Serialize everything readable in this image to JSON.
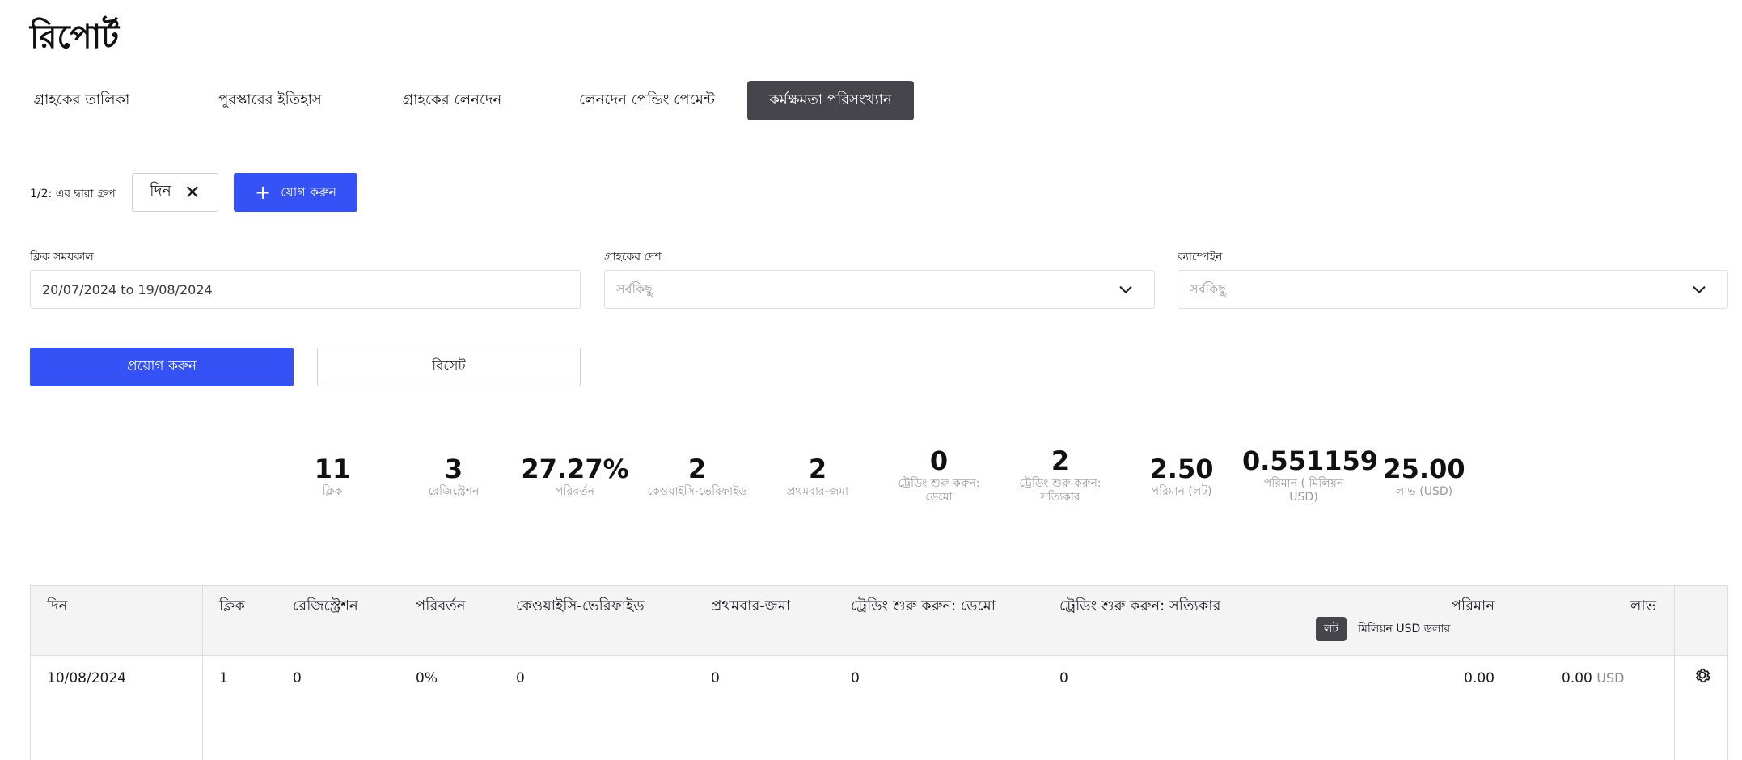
{
  "page": {
    "title": "রিপোর্ট"
  },
  "tabs": [
    {
      "label": "গ্রাহকের তালিকা",
      "active": false
    },
    {
      "label": "পুরস্কারের ইতিহাস",
      "active": false
    },
    {
      "label": "গ্রাহকের লেনদেন",
      "active": false
    },
    {
      "label": "লেনদেন পেন্ডিং পেমেন্ট",
      "active": false
    },
    {
      "label": "কর্মক্ষমতা পরিসংখ্যান",
      "active": true
    }
  ],
  "group_by": {
    "label": "1/2: এর দ্বারা গ্রুপ",
    "chip_label": "দিন",
    "add_button_label": "যোগ করুন"
  },
  "filters": {
    "period": {
      "label": "ক্লিক সময়কাল",
      "value": "20/07/2024 to 19/08/2024"
    },
    "country": {
      "label": "গ্রাহকের দেশ",
      "placeholder": "সর্বকিছু"
    },
    "campaign": {
      "label": "ক্যাম্পেইন",
      "placeholder": "সর্বকিছু"
    }
  },
  "actions": {
    "apply_label": "প্রয়োগ করুন",
    "reset_label": "রিসেট"
  },
  "stats": [
    {
      "value": "11",
      "label_lines": [
        "ক্লিক"
      ]
    },
    {
      "value": "3",
      "label_lines": [
        "রেজিস্ট্রেশন"
      ]
    },
    {
      "value": "27.27%",
      "label_lines": [
        "পরিবর্তন"
      ]
    },
    {
      "value": "2",
      "label_lines": [
        "কেওয়াইসি-ভেরিফাইড"
      ]
    },
    {
      "value": "2",
      "label_lines": [
        "প্রথমবার-জমা"
      ]
    },
    {
      "value": "0",
      "label_lines": [
        "ট্রেডিং শুরু করুন:",
        "ডেমো"
      ]
    },
    {
      "value": "2",
      "label_lines": [
        "ট্রেডিং শুরু করুন:",
        "সত্যিকার"
      ]
    },
    {
      "value": "2.50",
      "label_lines": [
        "পরিমান (লট)"
      ]
    },
    {
      "value": "0.551159",
      "label_lines": [
        "পরিমান ( মিলিয়ন",
        "USD)"
      ]
    },
    {
      "value": "25.00",
      "label_lines": [
        "লাভ (USD)"
      ]
    }
  ],
  "table": {
    "headers": {
      "day": "দিন",
      "clicks": "ক্লিক",
      "registrations": "রেজিস্ট্রেশন",
      "conversion": "পরিবর্তন",
      "kyc": "কেওয়াইসি-ভেরিফাইড",
      "first_deposit": "প্রথমবার-জমা",
      "trading_demo": "ট্রেডিং শুরু করুন: ডেমো",
      "trading_real": "ট্রেডিং শুরু করুন: সত্যিকার",
      "volume": "পরিমান",
      "profit": "লাভ"
    },
    "volume_units": {
      "active": "লট",
      "other": "মিলিয়ন USD ডলার"
    },
    "rows": [
      {
        "day": "10/08/2024",
        "clicks": "1",
        "registrations": "0",
        "conversion": "0%",
        "kyc": "0",
        "first_deposit": "0",
        "trading_demo": "0",
        "trading_real": "0",
        "volume": "0.00",
        "profit_value": "0.00",
        "profit_currency": "USD"
      }
    ]
  },
  "icons": {
    "chip_remove": "close-icon",
    "add": "plus-icon",
    "dropdown": "chevron-down-icon",
    "row_settings": "gear-icon"
  },
  "colors": {
    "primary": "#3452f5",
    "active_tab": "#46454b",
    "muted_text": "#9a9aa1"
  }
}
